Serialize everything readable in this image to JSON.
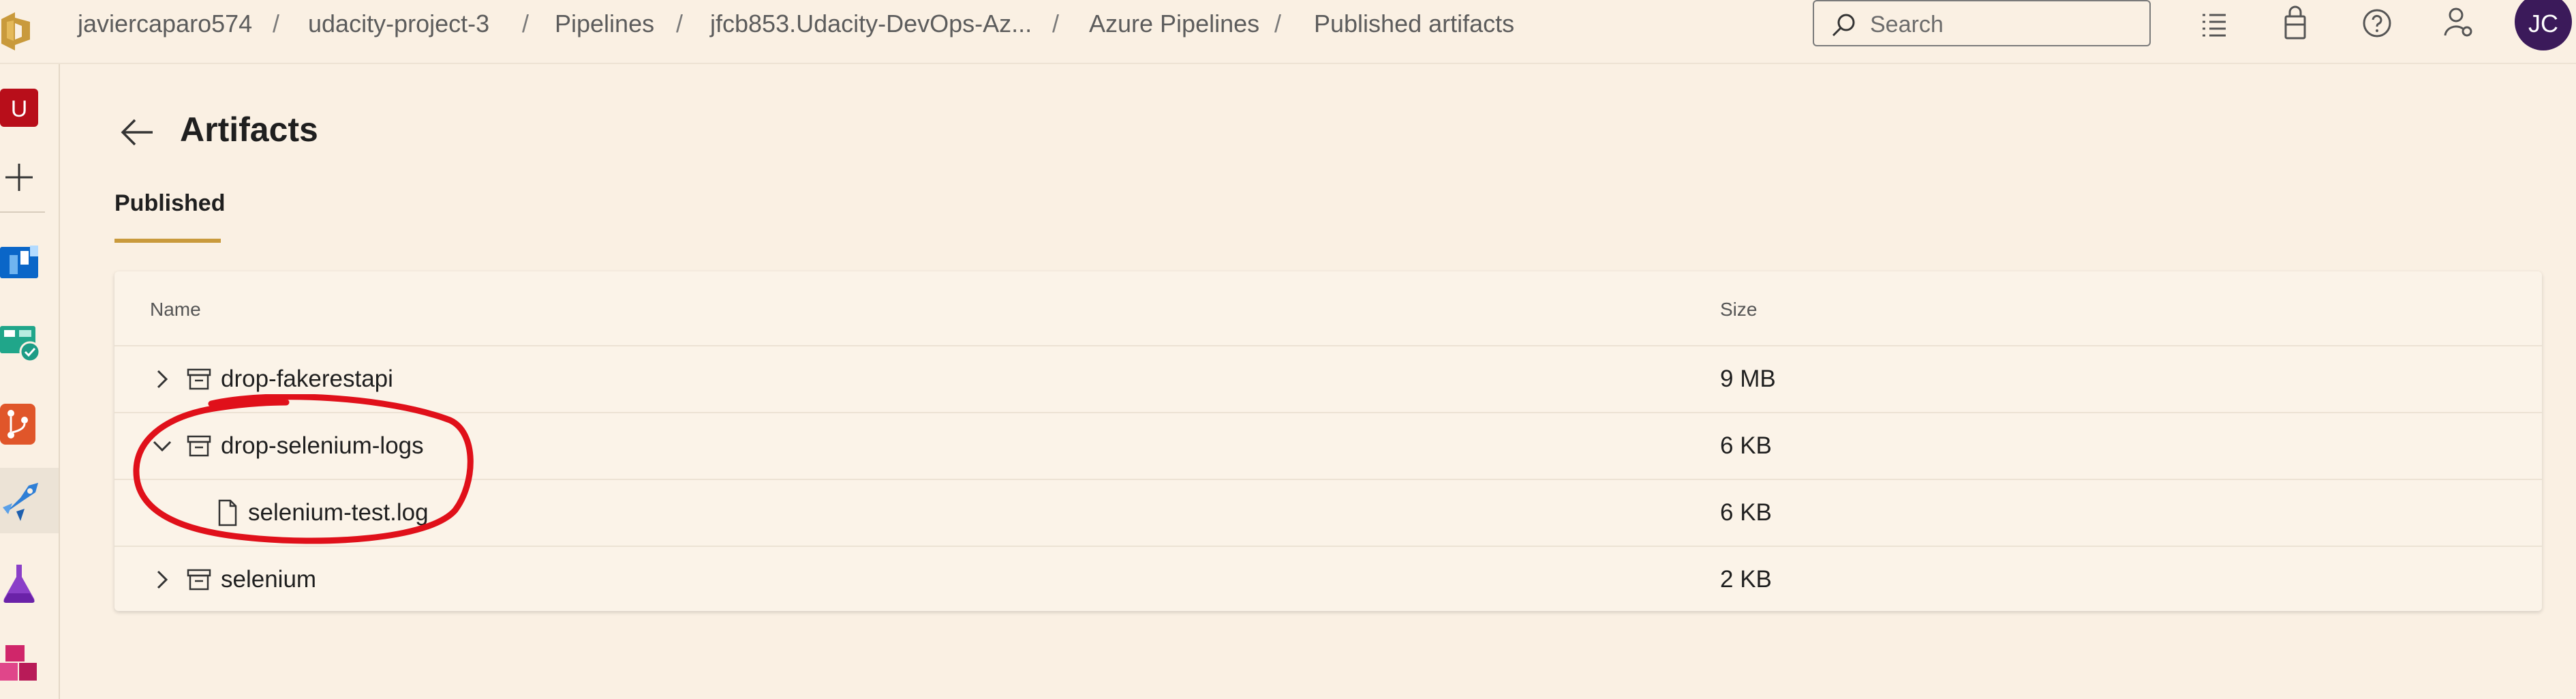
{
  "breadcrumb": {
    "items": [
      "javiercaparo574",
      "udacity-project-3",
      "Pipelines",
      "jfcb853.Udacity-DevOps-Az...",
      "Azure Pipelines",
      "Published artifacts"
    ],
    "separator": "/"
  },
  "search": {
    "placeholder": "Search"
  },
  "user": {
    "initials": "JC"
  },
  "sidebar": {
    "project_initial": "U",
    "items": [
      "overview-icon",
      "add-icon",
      "boards-icon",
      "test-plans-check-icon",
      "repos-icon",
      "pipelines-icon",
      "test-flask-icon",
      "artifacts-icon"
    ],
    "active": "pipelines-icon"
  },
  "page": {
    "title": "Artifacts",
    "tabs": [
      {
        "label": "Published",
        "selected": true
      }
    ]
  },
  "table": {
    "columns": {
      "name": "Name",
      "size": "Size"
    },
    "rows": [
      {
        "name": "drop-fakerestapi",
        "size": "9 MB",
        "type": "artifact",
        "expanded": false
      },
      {
        "name": "drop-selenium-logs",
        "size": "6 KB",
        "type": "artifact",
        "expanded": true
      },
      {
        "name": "selenium-test.log",
        "size": "6 KB",
        "type": "file",
        "indent": 1
      },
      {
        "name": "selenium",
        "size": "2 KB",
        "type": "artifact",
        "expanded": false
      }
    ]
  },
  "colors": {
    "background": "#faf0e3",
    "accent_underline": "#c99a3c",
    "avatar": "#3b1a5a",
    "annotation": "#e0101a"
  }
}
